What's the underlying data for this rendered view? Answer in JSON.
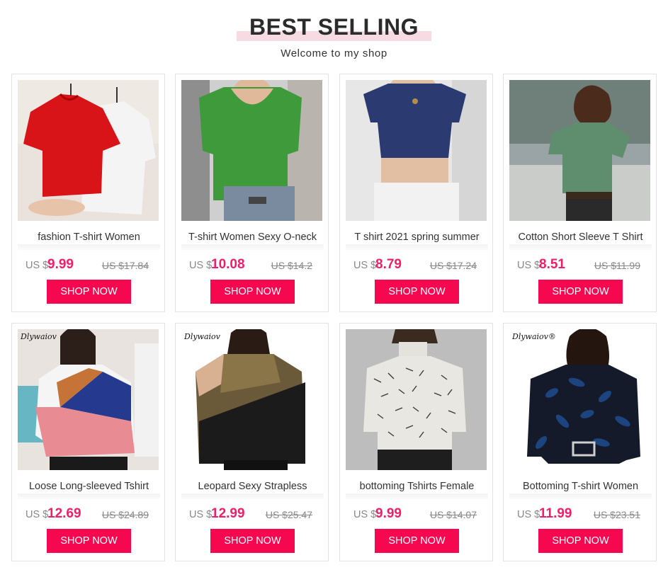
{
  "header": {
    "title": "BEST SELLING",
    "subtitle": "Welcome to my shop"
  },
  "products": [
    {
      "name": "fashion T-shirt Women",
      "currency": "US $",
      "price": "9.99",
      "old_price": "US $17.84",
      "button": "SHOP NOW",
      "brand": "",
      "image": "red-white-tshirts-photo"
    },
    {
      "name": "T-shirt Women Sexy O-neck",
      "currency": "US $",
      "price": "10.08",
      "old_price": "US $14.2",
      "button": "SHOP NOW",
      "brand": "",
      "image": "green-tshirt-photo"
    },
    {
      "name": "T shirt 2021 spring summer",
      "currency": "US $",
      "price": "8.79",
      "old_price": "US $17.24",
      "button": "SHOP NOW",
      "brand": "",
      "image": "navy-crop-top-photo"
    },
    {
      "name": "Cotton Short Sleeve T Shirt",
      "currency": "US $",
      "price": "8.51",
      "old_price": "US $11.99",
      "button": "SHOP NOW",
      "brand": "",
      "image": "green-vneck-street-photo"
    },
    {
      "name": "Loose Long-sleeved Tshirt",
      "currency": "US $",
      "price": "12.69",
      "old_price": "US $24.89",
      "button": "SHOP NOW",
      "brand": "Dlywaiov",
      "image": "colorblock-sweatshirt-photo"
    },
    {
      "name": "Leopard Sexy Strapless",
      "currency": "US $",
      "price": "12.99",
      "old_price": "US $25.47",
      "button": "SHOP NOW",
      "brand": "Dlywaiov",
      "image": "leopard-cold-shoulder-photo"
    },
    {
      "name": "bottoming Tshirts Female",
      "currency": "US $",
      "price": "9.99",
      "old_price": "US $14.07",
      "button": "SHOP NOW",
      "brand": "",
      "image": "print-turtleneck-photo"
    },
    {
      "name": "Bottoming T-shirt Women",
      "currency": "US $",
      "price": "11.99",
      "old_price": "US $23.51",
      "button": "SHOP NOW",
      "brand": "Dlywaiov®",
      "image": "velvet-leaf-top-photo"
    }
  ],
  "colors": {
    "accent": "#f5084f",
    "price": "#ee1f6a",
    "title_bar": "#f6dbe3",
    "border": "#e3e3e3"
  }
}
